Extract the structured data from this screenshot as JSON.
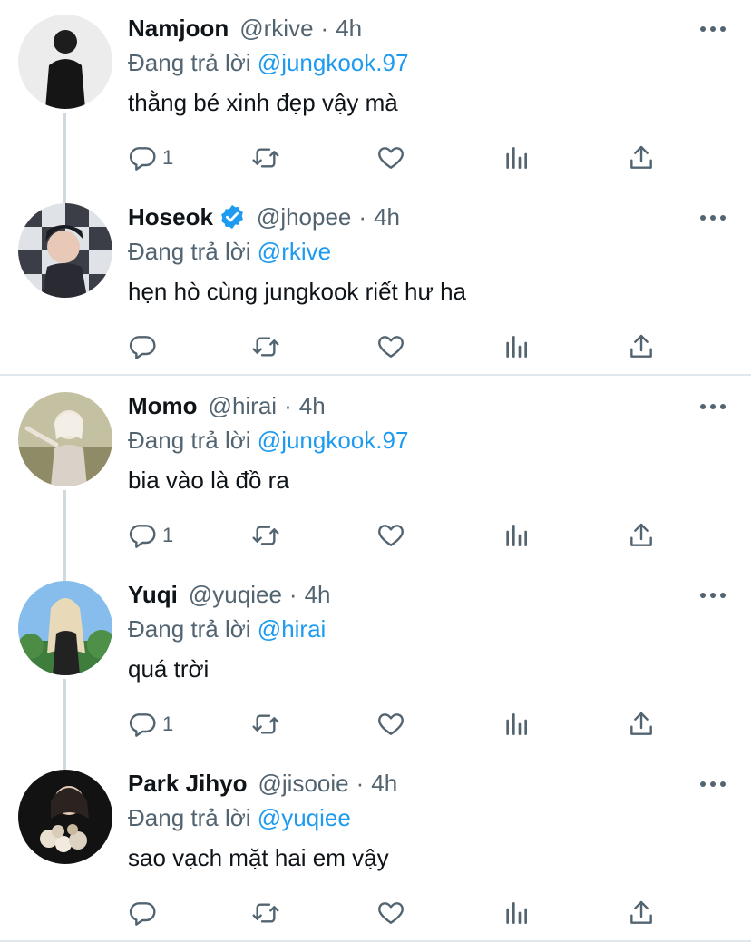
{
  "tweets": [
    {
      "name": "Namjoon",
      "verified": false,
      "handle": "@rkive",
      "dot": "·",
      "time": "4h",
      "reply_prefix": "Đang trả lời",
      "reply_mention": "@jungkook.97",
      "text": "thằng bé xinh đẹp vậy mà",
      "reply_count": "1",
      "avatar_colors": [
        "#e9e9e9",
        "#1c1c1c"
      ]
    },
    {
      "name": "Hoseok",
      "verified": true,
      "handle": "@jhopee",
      "dot": "·",
      "time": "4h",
      "reply_prefix": "Đang trả lời",
      "reply_mention": "@rkive",
      "text": "hẹn hò cùng jungkook riết hư ha",
      "reply_count": "",
      "avatar_colors": [
        "#d8dbe0",
        "#2a2a35"
      ]
    },
    {
      "name": "Momo",
      "verified": false,
      "handle": "@hirai",
      "dot": "·",
      "time": "4h",
      "reply_prefix": "Đang trả lời",
      "reply_mention": "@jungkook.97",
      "text": "bia vào là đồ ra",
      "reply_count": "1",
      "avatar_colors": [
        "#c9c3a8",
        "#8a8460"
      ]
    },
    {
      "name": "Yuqi",
      "verified": false,
      "handle": "@yuqiee",
      "dot": "·",
      "time": "4h",
      "reply_prefix": "Đang trả lời",
      "reply_mention": "@hirai",
      "text": "quá trời",
      "reply_count": "1",
      "avatar_colors": [
        "#7fb4e6",
        "#3f7a3a"
      ]
    },
    {
      "name": "Park Jihyo",
      "verified": false,
      "handle": "@jisooie",
      "dot": "·",
      "time": "4h",
      "reply_prefix": "Đang trả lời",
      "reply_mention": "@yuqiee",
      "text": "sao vạch mặt hai em vậy",
      "reply_count": "",
      "avatar_colors": [
        "#111111",
        "#e8dccf"
      ]
    }
  ],
  "colors": {
    "text": "#0f1419",
    "secondary": "#536471",
    "accent": "#1d9bf0",
    "thread_line": "#cfd9de",
    "divider": "#e1e8ed"
  },
  "icons": [
    "reply-icon",
    "retweet-icon",
    "like-icon",
    "view-stats-icon",
    "share-icon",
    "more-icon",
    "verified-badge-icon"
  ]
}
